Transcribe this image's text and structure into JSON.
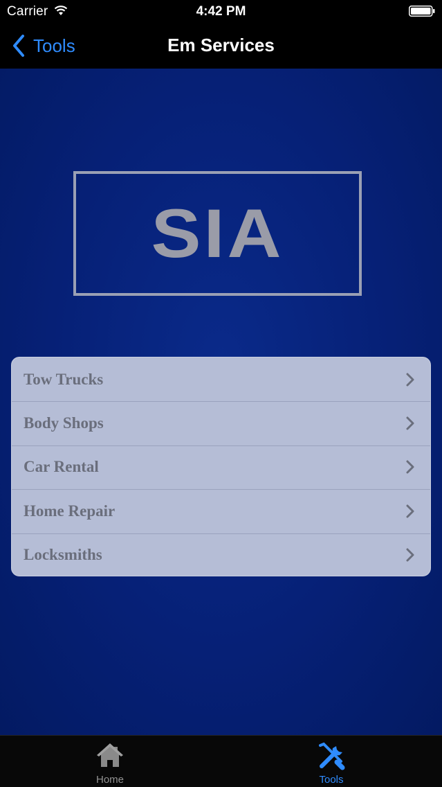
{
  "status_bar": {
    "carrier": "Carrier",
    "time": "4:42 PM",
    "wifi_icon": "wifi-icon",
    "battery_icon": "battery-icon"
  },
  "nav": {
    "back_label": "Tools",
    "title": "Em Services",
    "back_icon": "chevron-left-icon"
  },
  "logo": {
    "text": "SIA"
  },
  "menu": {
    "items": [
      {
        "label": "Tow Trucks"
      },
      {
        "label": "Body Shops"
      },
      {
        "label": "Car Rental"
      },
      {
        "label": "Home Repair"
      },
      {
        "label": "Locksmiths"
      }
    ],
    "chevron_icon": "chevron-right-icon"
  },
  "tab_bar": {
    "tabs": [
      {
        "label": "Home",
        "icon": "house-icon",
        "selected": false
      },
      {
        "label": "Tools",
        "icon": "tools-icon",
        "selected": true
      }
    ]
  },
  "colors": {
    "accent": "#2f8cff",
    "background": "#062076",
    "menu_background": "#b5bdd6",
    "menu_text": "#6a6e7c",
    "logo_gray": "#9a9ca8"
  }
}
